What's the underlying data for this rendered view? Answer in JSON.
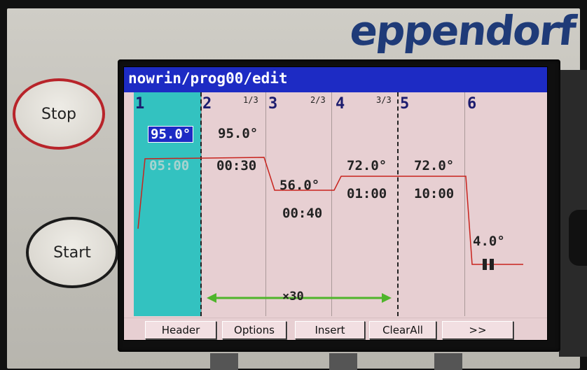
{
  "brand": "eppendorf",
  "buttons": {
    "stop": "Stop",
    "start": "Start"
  },
  "window": {
    "title": "nowrin/prog00/edit"
  },
  "steps": [
    {
      "number": "1",
      "temperature": "95.0°",
      "time": "05:00",
      "selected": true
    },
    {
      "number": "2",
      "cycle_fraction": "1/3",
      "temperature": "95.0°",
      "time": "00:30"
    },
    {
      "number": "3",
      "cycle_fraction": "2/3",
      "temperature": "56.0°",
      "time": "00:40"
    },
    {
      "number": "4",
      "cycle_fraction": "3/3",
      "temperature": "72.0°",
      "time": "01:00"
    },
    {
      "number": "5",
      "temperature": "72.0°",
      "time": "10:00"
    },
    {
      "number": "6",
      "temperature": "4.0°",
      "time_icon": "pause-icon"
    }
  ],
  "cycle": {
    "label": "×30"
  },
  "colors": {
    "title_bar": "#1d2bc4",
    "selected_step": "#33c2c0",
    "profile_line": "#c8231d",
    "cycle_arrow": "#4fb52b"
  },
  "footer": {
    "buttons": [
      "Header",
      "Options",
      "Insert",
      "ClearAll",
      ">>"
    ]
  }
}
